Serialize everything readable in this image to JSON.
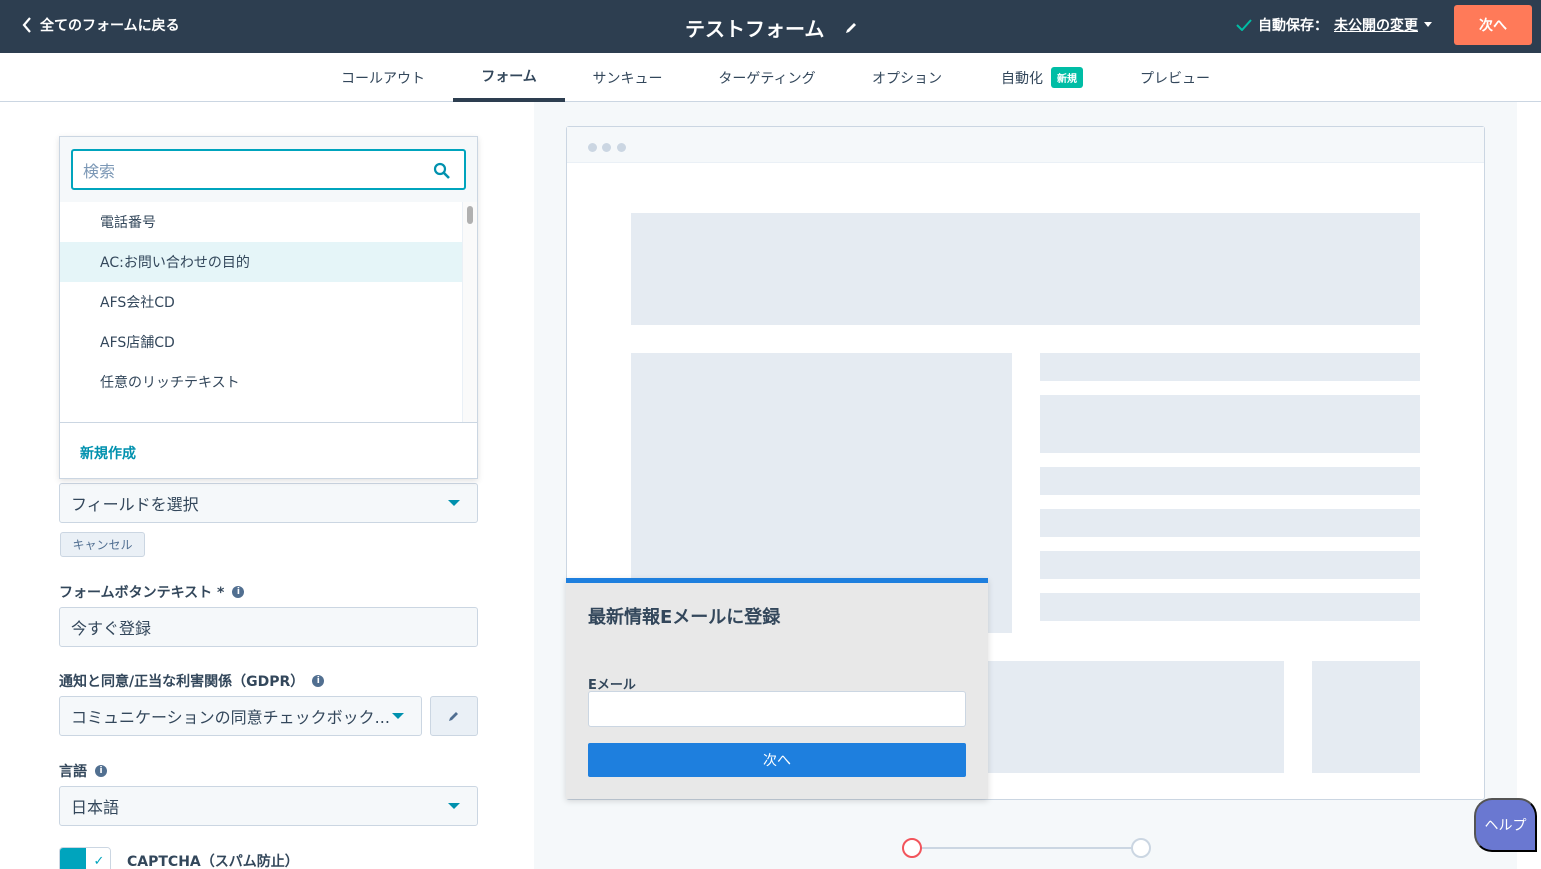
{
  "header": {
    "back_label": "全てのフォームに戻る",
    "form_title": "テストフォーム",
    "autosave_label": "自動保存：",
    "unpublished_label": "未公開の変更",
    "next_label": "次へ"
  },
  "tabs": [
    {
      "label": "コールアウト"
    },
    {
      "label": "フォーム",
      "active": true
    },
    {
      "label": "サンキュー"
    },
    {
      "label": "ターゲティング"
    },
    {
      "label": "オプション"
    },
    {
      "label": "自動化",
      "badge": "新規"
    },
    {
      "label": "プレビュー"
    }
  ],
  "field_dropdown": {
    "search_placeholder": "検索",
    "items": [
      "電話番号",
      "AC:お問い合わせの目的",
      "AFS会社CD",
      "AFS店舗CD",
      "任意のリッチテキスト"
    ],
    "hovered_index": 1,
    "create_label": "新規作成"
  },
  "settings": {
    "field_select_placeholder": "フィールドを選択",
    "cancel_label": "キャンセル",
    "button_text_label": "フォームボタンテキスト *",
    "button_text_value": "今すぐ登録",
    "gdpr_label": "通知と同意/正当な利害関係（GDPR）",
    "gdpr_value": "コミュニケーションの同意チェックボック...",
    "language_label": "言語",
    "language_value": "日本語",
    "captcha_label": "CAPTCHA（スパム防止）",
    "captcha_enabled": true
  },
  "preview": {
    "popup_title": "最新情報Eメールに登録",
    "email_label": "Eメール",
    "submit_label": "次へ"
  },
  "help_label": "ヘルプ",
  "colors": {
    "topbar": "#2d3e50",
    "accent_orange": "#ff7a59",
    "accent_teal": "#00a4bd",
    "badge_green": "#00bda5",
    "cta_blue": "#1e7fde",
    "help_purple": "#6a78d1",
    "step_active": "#f2545b"
  }
}
